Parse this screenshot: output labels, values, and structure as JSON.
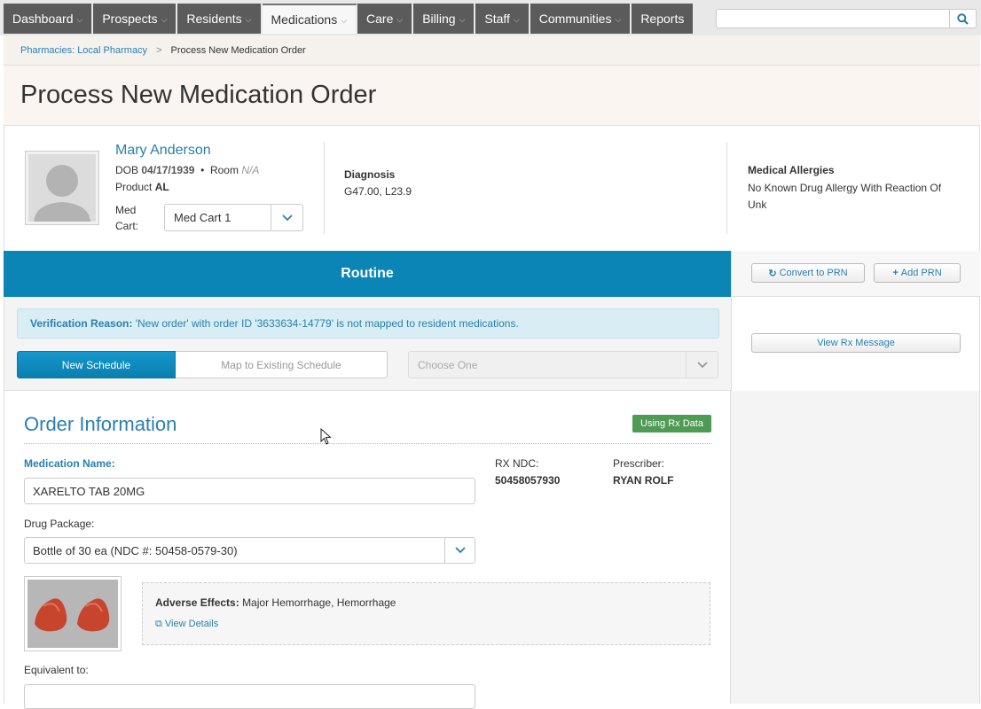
{
  "nav": {
    "items": [
      {
        "label": "Dashboard",
        "has_menu": true
      },
      {
        "label": "Prospects",
        "has_menu": true
      },
      {
        "label": "Residents",
        "has_menu": true
      },
      {
        "label": "Medications",
        "has_menu": true,
        "active": true
      },
      {
        "label": "Care",
        "has_menu": true
      },
      {
        "label": "Billing",
        "has_menu": true
      },
      {
        "label": "Staff",
        "has_menu": true
      },
      {
        "label": "Communities",
        "has_menu": true
      },
      {
        "label": "Reports",
        "has_menu": false
      }
    ],
    "search_placeholder": ""
  },
  "breadcrumb": {
    "parent": "Pharmacies: Local Pharmacy",
    "separator": ">",
    "current": "Process New Medication Order"
  },
  "page_title": "Process New Medication Order",
  "resident": {
    "name": "Mary Anderson",
    "dob_label": "DOB",
    "dob": "04/17/1939",
    "bullet": "•",
    "room_label": "Room",
    "room": "N/A",
    "product_label": "Product",
    "product": "AL",
    "med_cart_label": "Med Cart:",
    "med_cart": "Med Cart 1",
    "diagnosis_label": "Diagnosis",
    "diagnosis": "G47.00, L23.9",
    "allergies_label": "Medical Allergies",
    "allergies": "No Known Drug Allergy With Reaction Of Unk"
  },
  "routine": {
    "label": "Routine",
    "convert_prn": "Convert to PRN",
    "add_prn": "Add PRN",
    "view_rx": "View Rx Message"
  },
  "verification": {
    "label": "Verification Reason:",
    "text": "'New order' with order ID '3633634-14779' is not mapped to resident medications.",
    "new_schedule": "New Schedule",
    "map_existing": "Map to Existing Schedule",
    "choose_one": "Choose One"
  },
  "order": {
    "title": "Order Information",
    "badge": "Using Rx Data",
    "med_name_label": "Medication Name:",
    "med_name": "XARELTO TAB 20MG",
    "rx_ndc_label": "RX NDC:",
    "rx_ndc": "50458057930",
    "prescriber_label": "Prescriber:",
    "prescriber": "RYAN ROLF",
    "drug_package_label": "Drug Package:",
    "drug_package": "Bottle of 30 ea (NDC #: 50458-0579-30)",
    "adverse_label": "Adverse Effects:",
    "adverse": "Major Hemorrhage, Hemorrhage",
    "view_details": "View Details",
    "equivalent_label": "Equivalent to:",
    "equivalent": ""
  },
  "colors": {
    "nav_bg": "#5b5b5b",
    "accent": "#0b85b6",
    "link": "#2a7fb0",
    "badge_green": "#4f9a54"
  }
}
